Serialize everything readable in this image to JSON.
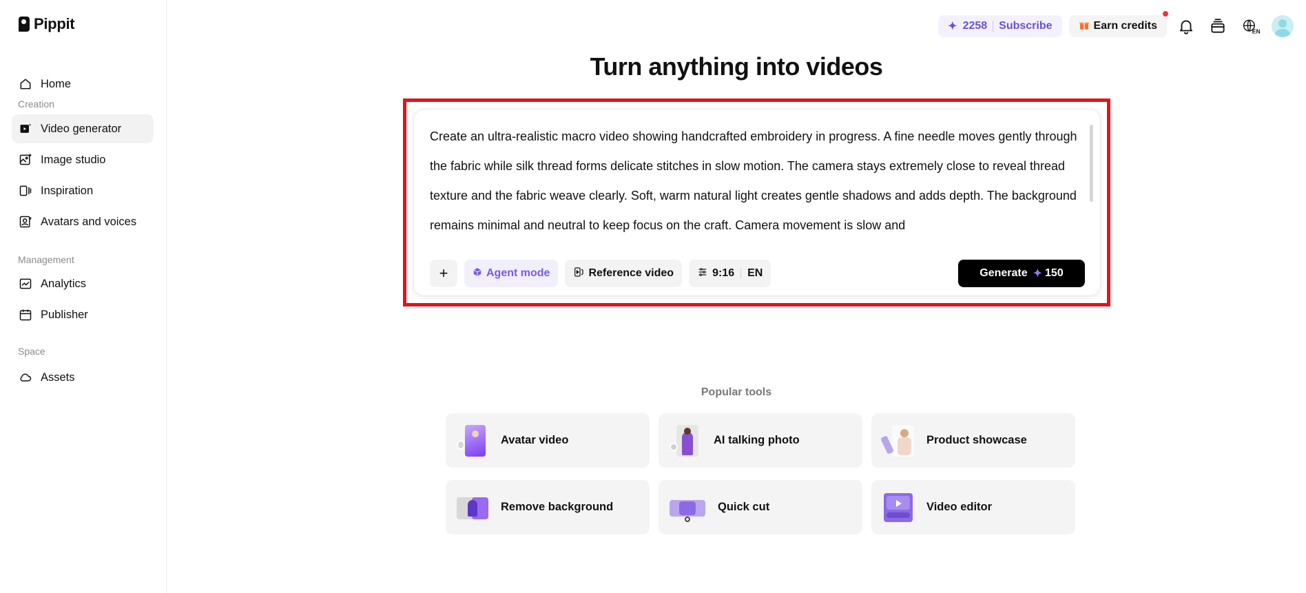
{
  "brand": {
    "name": "Pippit"
  },
  "sidebar": {
    "home": "Home",
    "creation_label": "Creation",
    "creation_items": [
      "Video generator",
      "Image studio",
      "Inspiration",
      "Avatars and voices"
    ],
    "management_label": "Management",
    "management_items": [
      "Analytics",
      "Publisher"
    ],
    "space_label": "Space",
    "space_items": [
      "Assets"
    ],
    "active_item": "Video generator"
  },
  "header": {
    "credits": "2258",
    "subscribe": "Subscribe",
    "earn_credits": "Earn credits",
    "language": "EN"
  },
  "main": {
    "title": "Turn anything into videos",
    "prompt_text": "Create an ultra-realistic macro video showing handcrafted embroidery in progress. A fine needle moves gently through the fabric while silk thread forms delicate stitches in slow motion. The camera stays extremely close to reveal thread texture and the fabric weave clearly. Soft, warm natural light creates gentle shadows and adds depth. The background remains minimal and neutral to keep focus on the craft. Camera movement is slow and",
    "toolbar": {
      "plus": "+",
      "agent_mode": "Agent mode",
      "reference_video": "Reference video",
      "ratio": "9:16",
      "lang": "EN"
    },
    "generate": {
      "label": "Generate",
      "cost": "150"
    },
    "popular_label": "Popular tools",
    "tools": [
      "Avatar video",
      "AI talking photo",
      "Product showcase",
      "Remove background",
      "Quick cut",
      "Video editor"
    ]
  },
  "colors": {
    "accent": "#6b4fd8",
    "highlight": "#e0141c",
    "notification": "#ff2a3d"
  }
}
